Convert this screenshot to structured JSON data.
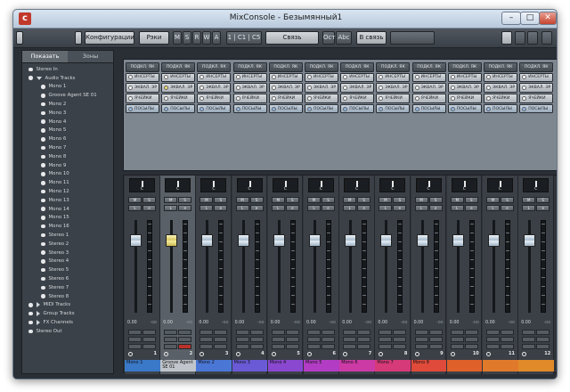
{
  "window": {
    "title": "MixConsole - Безымянный1",
    "logo": "c",
    "minimize_glyph": "–",
    "maximize_glyph": "□",
    "close_glyph": "✕"
  },
  "toolbar": {
    "config_label": "Конфигурации",
    "racks_label": "Рэки",
    "m_label": "M",
    "s_label": "S",
    "r_label": "R",
    "w_label": "W",
    "a_label": "A",
    "ab_label": "1 | C1 | C5",
    "link_label": "Связь",
    "ost_label": "Ост",
    "abc_label": "Abc",
    "bus_label": "В связь",
    "icon_names": [
      "config-icon",
      "grid-icon",
      "window-icon",
      "wrench-icon"
    ]
  },
  "sidebar": {
    "tabs": [
      {
        "label": "Показать"
      },
      {
        "label": "Зоны"
      }
    ],
    "items": [
      {
        "label": "Stereo In",
        "type": "dot"
      },
      {
        "label": "Audio Tracks",
        "type": "folder-open"
      },
      {
        "label": "Mono 1",
        "type": "child"
      },
      {
        "label": "Groove Agent SE 01",
        "type": "child"
      },
      {
        "label": "Mono 2",
        "type": "child"
      },
      {
        "label": "Mono 3",
        "type": "child"
      },
      {
        "label": "Mono 4",
        "type": "child"
      },
      {
        "label": "Mono 5",
        "type": "child"
      },
      {
        "label": "Mono 6",
        "type": "child"
      },
      {
        "label": "Mono 7",
        "type": "child"
      },
      {
        "label": "Mono 8",
        "type": "child"
      },
      {
        "label": "Mono 9",
        "type": "child"
      },
      {
        "label": "Mono 10",
        "type": "child"
      },
      {
        "label": "Mono 11",
        "type": "child"
      },
      {
        "label": "Mono 12",
        "type": "child"
      },
      {
        "label": "Mono 13",
        "type": "child"
      },
      {
        "label": "Mono 14",
        "type": "child"
      },
      {
        "label": "Mono 15",
        "type": "child"
      },
      {
        "label": "Mono 16",
        "type": "child"
      },
      {
        "label": "Stereo 1",
        "type": "child"
      },
      {
        "label": "Stereo 2",
        "type": "child"
      },
      {
        "label": "Stereo 3",
        "type": "child"
      },
      {
        "label": "Stereo 4",
        "type": "child"
      },
      {
        "label": "Stereo 5",
        "type": "child"
      },
      {
        "label": "Stereo 6",
        "type": "child"
      },
      {
        "label": "Stereo 7",
        "type": "child"
      },
      {
        "label": "Stereo 8",
        "type": "child"
      },
      {
        "label": "MIDI Tracks",
        "type": "folder-closed"
      },
      {
        "label": "Group Tracks",
        "type": "folder-closed"
      },
      {
        "label": "FX Channels",
        "type": "folder-closed"
      },
      {
        "label": "Stereo Out",
        "type": "dot"
      }
    ]
  },
  "inserts": {
    "header": "ПОДКЛ. ЯК",
    "rows": [
      "ИНСЕРТЫ",
      "ЭКВАЛ. ЭР",
      "ЯЧЕЙКИ",
      "ПОСЫЛЫ"
    ]
  },
  "strip_common": {
    "pan_label": "C",
    "m": "M",
    "s": "S",
    "l": "L",
    "e": "e",
    "vol": "0.00",
    "peak": "-oo"
  },
  "channels": [
    {
      "num": "1",
      "name": "Mono 1",
      "color": "#3a78c8",
      "selected": false,
      "level": 0.78
    },
    {
      "num": "2",
      "name": "Groove Agent SE 01",
      "color": "#bfc5cb",
      "selected": true,
      "level": 0.78
    },
    {
      "num": "3",
      "name": "Mono 2",
      "color": "#4a77d6",
      "selected": false,
      "level": 0.78
    },
    {
      "num": "4",
      "name": "Mono 3",
      "color": "#6a5ad6",
      "selected": false,
      "level": 0.78
    },
    {
      "num": "5",
      "name": "Mono 4",
      "color": "#8a47d0",
      "selected": false,
      "level": 0.78
    },
    {
      "num": "6",
      "name": "Mono 5",
      "color": "#b23cc4",
      "selected": false,
      "level": 0.78
    },
    {
      "num": "7",
      "name": "Mono 6",
      "color": "#cc3aa6",
      "selected": false,
      "level": 0.78
    },
    {
      "num": "8",
      "name": "Mono 7",
      "color": "#d63a78",
      "selected": false,
      "level": 0.78
    },
    {
      "num": "9",
      "name": "Mono 8",
      "color": "#e04a3a",
      "selected": false,
      "level": 0.78
    },
    {
      "num": "10",
      "name": "",
      "color": "#e0602a",
      "selected": false,
      "level": 0.78
    },
    {
      "num": "11",
      "name": "",
      "color": "#e07a2a",
      "selected": false,
      "level": 0.78
    },
    {
      "num": "12",
      "name": "",
      "color": "#e08a2a",
      "selected": false,
      "level": 0.78
    }
  ],
  "colors": {
    "window_bg": "#2a2f36",
    "panel_bg": "#3b4148",
    "fader_cap": "#dbe6f0",
    "selected_cap": "#f0e48a"
  }
}
